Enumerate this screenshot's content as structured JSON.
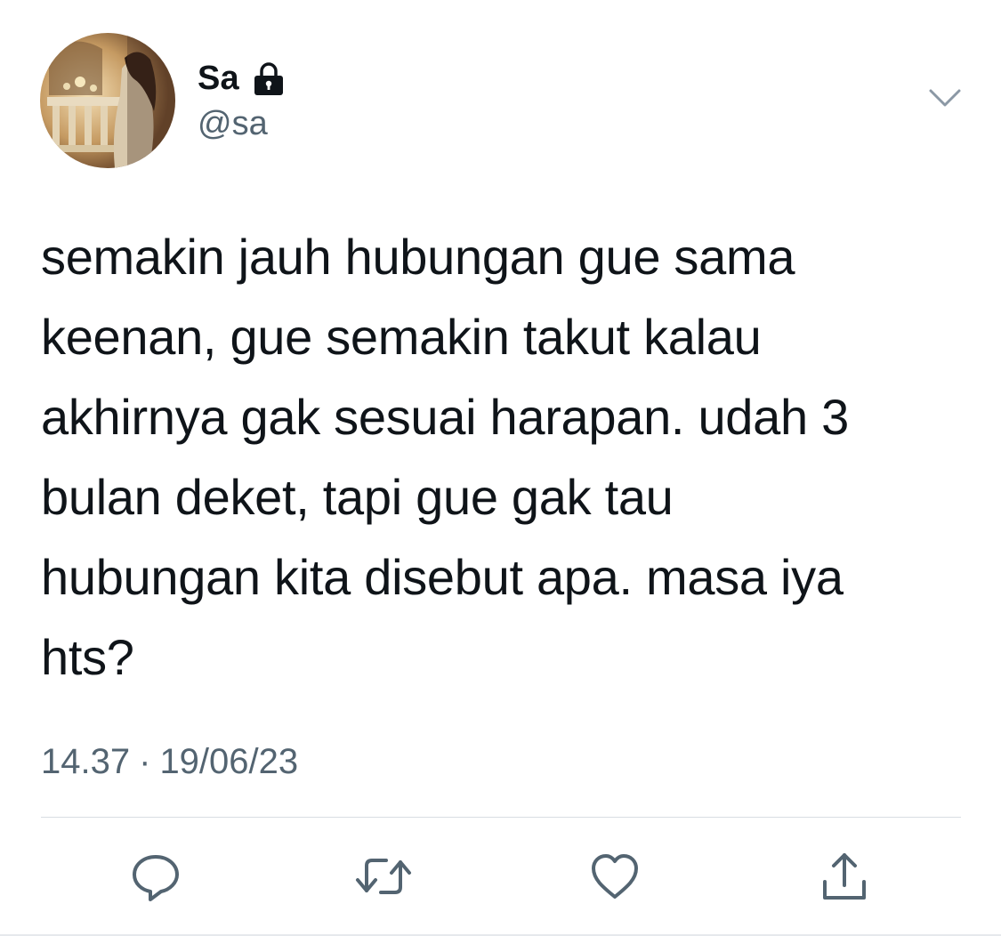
{
  "tweet": {
    "display_name": "Sa",
    "handle": "@sa",
    "protected_icon": "lock-icon",
    "menu_icon": "chevron-down-icon",
    "text": "semakin jauh hubungan gue sama\nkeenan, gue semakin takut kalau\nakhirnya gak sesuai harapan. udah 3\nbulan deket, tapi gue gak tau\nhubungan kita disebut apa. masa iya\nhts?",
    "time": "14.37",
    "separator": "·",
    "date": "19/06/23"
  },
  "actions": [
    {
      "icon": "reply-icon"
    },
    {
      "icon": "retweet-icon"
    },
    {
      "icon": "like-icon"
    },
    {
      "icon": "share-icon"
    }
  ],
  "colors": {
    "text": "#0f1419",
    "secondary": "#536471",
    "icon": "#536471",
    "divider": "#d8dee3"
  }
}
